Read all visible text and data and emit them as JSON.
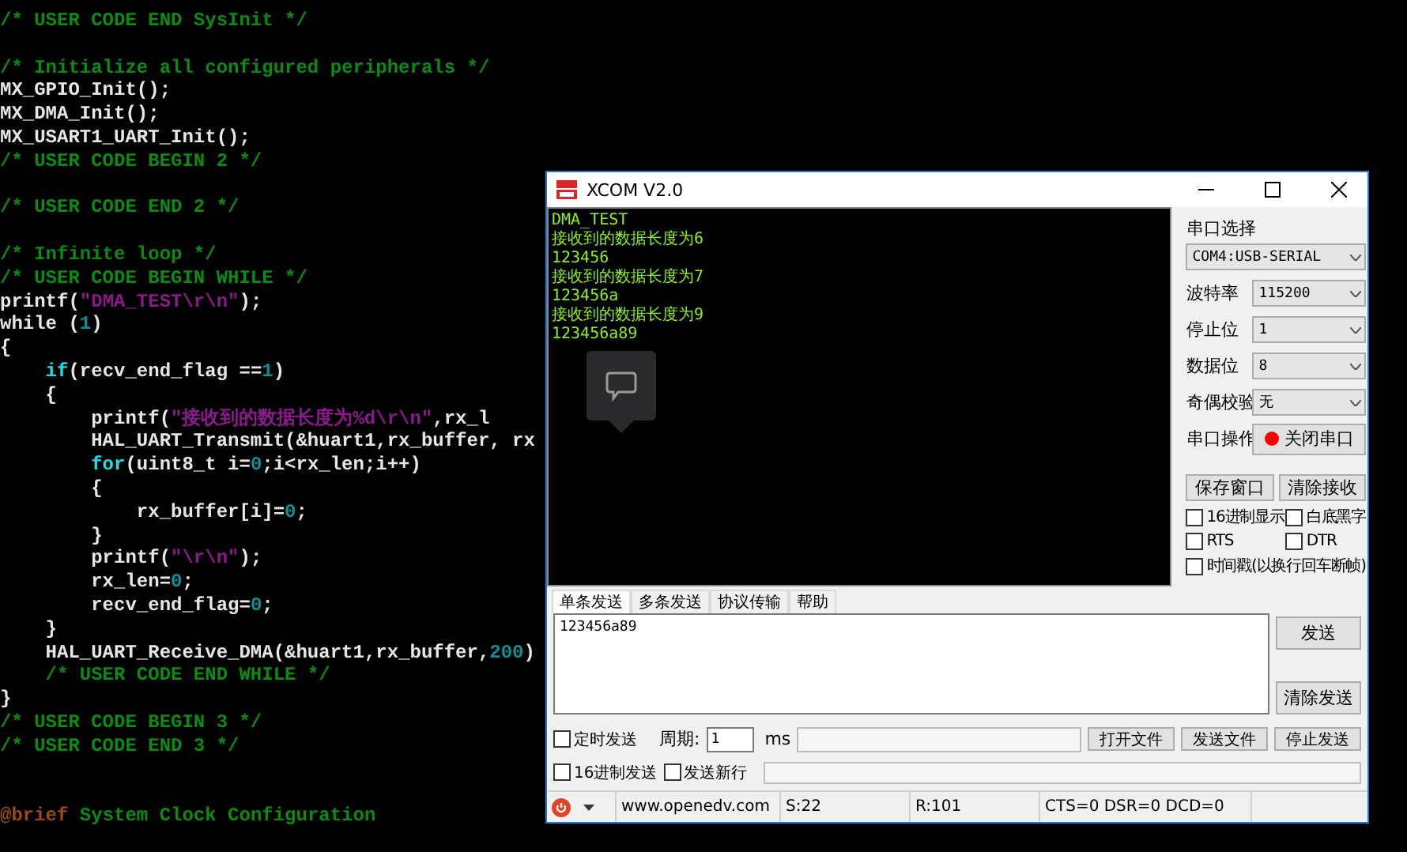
{
  "editor": {
    "lines": [
      {
        "kind": "code",
        "tokens": [
          {
            "kind": "comment",
            "text": "/* USER CODE END SysInit */"
          }
        ]
      },
      {
        "kind": "blank"
      },
      {
        "kind": "code",
        "tokens": [
          {
            "kind": "comment",
            "text": "/* Initialize all configured peripherals */"
          }
        ]
      },
      {
        "kind": "code",
        "tokens": [
          {
            "kind": "plain",
            "text": "MX_GPIO_Init();"
          }
        ]
      },
      {
        "kind": "code",
        "tokens": [
          {
            "kind": "plain",
            "text": "MX_DMA_Init();"
          }
        ]
      },
      {
        "kind": "code",
        "tokens": [
          {
            "kind": "plain",
            "text": "MX_USART1_UART_Init();"
          }
        ]
      },
      {
        "kind": "code",
        "tokens": [
          {
            "kind": "comment",
            "text": "/* USER CODE BEGIN 2 */"
          }
        ]
      },
      {
        "kind": "blank"
      },
      {
        "kind": "code",
        "tokens": [
          {
            "kind": "comment",
            "text": "/* USER CODE END 2 */"
          }
        ]
      },
      {
        "kind": "blank"
      },
      {
        "kind": "code",
        "tokens": [
          {
            "kind": "comment",
            "text": "/* Infinite loop */"
          }
        ]
      },
      {
        "kind": "code",
        "tokens": [
          {
            "kind": "comment",
            "text": "/* USER CODE BEGIN WHILE */"
          }
        ]
      },
      {
        "kind": "code",
        "tokens": [
          {
            "kind": "plain",
            "text": "printf("
          },
          {
            "kind": "string",
            "text": "\"DMA_TEST\\r\\n\""
          },
          {
            "kind": "plain",
            "text": ");"
          }
        ]
      },
      {
        "kind": "code",
        "tokens": [
          {
            "kind": "plain",
            "text": "while ("
          },
          {
            "kind": "number",
            "text": "1"
          },
          {
            "kind": "plain",
            "text": ")"
          }
        ]
      },
      {
        "kind": "code",
        "tokens": [
          {
            "kind": "plain",
            "text": "{"
          }
        ]
      },
      {
        "kind": "code",
        "tokens": [
          {
            "kind": "keyword",
            "text": "    if"
          },
          {
            "kind": "plain",
            "text": "(recv_end_flag =="
          },
          {
            "kind": "number",
            "text": "1"
          },
          {
            "kind": "plain",
            "text": ")"
          }
        ]
      },
      {
        "kind": "code",
        "tokens": [
          {
            "kind": "plain",
            "text": "    {"
          }
        ]
      },
      {
        "kind": "code",
        "tokens": [
          {
            "kind": "plain",
            "text": "        printf("
          },
          {
            "kind": "string",
            "text": "\"接收到的数据长度为%d\\r\\n\""
          },
          {
            "kind": "plain",
            "text": ",rx_l"
          }
        ]
      },
      {
        "kind": "code",
        "tokens": [
          {
            "kind": "plain",
            "text": "        HAL_UART_Transmit(&huart1,rx_buffer, rx"
          }
        ]
      },
      {
        "kind": "code",
        "tokens": [
          {
            "kind": "keyword",
            "text": "        for"
          },
          {
            "kind": "plain",
            "text": "(uint8_t i="
          },
          {
            "kind": "number",
            "text": "0"
          },
          {
            "kind": "plain",
            "text": ";i<rx_len;i++)"
          }
        ]
      },
      {
        "kind": "code",
        "tokens": [
          {
            "kind": "plain",
            "text": "        {"
          }
        ]
      },
      {
        "kind": "code",
        "tokens": [
          {
            "kind": "plain",
            "text": "            rx_buffer[i]="
          },
          {
            "kind": "number",
            "text": "0"
          },
          {
            "kind": "plain",
            "text": ";"
          }
        ]
      },
      {
        "kind": "code",
        "tokens": [
          {
            "kind": "plain",
            "text": "        }"
          }
        ]
      },
      {
        "kind": "code",
        "tokens": [
          {
            "kind": "plain",
            "text": "        printf("
          },
          {
            "kind": "string",
            "text": "\"\\r\\n\""
          },
          {
            "kind": "plain",
            "text": ");"
          }
        ]
      },
      {
        "kind": "code",
        "tokens": [
          {
            "kind": "plain",
            "text": "        rx_len="
          },
          {
            "kind": "number",
            "text": "0"
          },
          {
            "kind": "plain",
            "text": ";"
          }
        ]
      },
      {
        "kind": "code",
        "tokens": [
          {
            "kind": "plain",
            "text": "        recv_end_flag="
          },
          {
            "kind": "number",
            "text": "0"
          },
          {
            "kind": "plain",
            "text": ";"
          }
        ]
      },
      {
        "kind": "code",
        "tokens": [
          {
            "kind": "plain",
            "text": "    }"
          }
        ]
      },
      {
        "kind": "code",
        "tokens": [
          {
            "kind": "plain",
            "text": "    HAL_UART_Receive_DMA(&huart1,rx_buffer,"
          },
          {
            "kind": "number",
            "text": "200"
          },
          {
            "kind": "plain",
            "text": ")"
          }
        ]
      },
      {
        "kind": "code",
        "tokens": [
          {
            "kind": "comment",
            "text": "    /* USER CODE END WHILE */"
          }
        ]
      },
      {
        "kind": "code",
        "tokens": [
          {
            "kind": "plain",
            "text": "}"
          }
        ]
      },
      {
        "kind": "code",
        "tokens": [
          {
            "kind": "comment",
            "text": "/* USER CODE BEGIN 3 */"
          }
        ]
      },
      {
        "kind": "code",
        "tokens": [
          {
            "kind": "comment",
            "text": "/* USER CODE END 3 */"
          }
        ]
      },
      {
        "kind": "blank"
      },
      {
        "kind": "blank"
      },
      {
        "kind": "code",
        "tokens": [
          {
            "kind": "doctag",
            "text": "@brief"
          },
          {
            "kind": "comment",
            "text": " System Clock Configuration"
          }
        ]
      }
    ]
  },
  "xcom": {
    "title": "XCOM V2.0",
    "receive_lines": [
      "DMA_TEST",
      "接收到的数据长度为6",
      "123456",
      "接收到的数据长度为7",
      "123456a",
      "接收到的数据长度为9",
      "123456a89"
    ],
    "port_label": "串口选择",
    "port_value": "COM4:USB-SERIAL",
    "settings": [
      {
        "label": "波特率",
        "value": "115200"
      },
      {
        "label": "停止位",
        "value": "1"
      },
      {
        "label": "数据位",
        "value": "8"
      },
      {
        "label": "奇偶校验",
        "value": "无"
      }
    ],
    "operation_label": "串口操作",
    "operation_button": {
      "label": "关闭串口",
      "open": true
    },
    "receive_buttons": [
      "保存窗口",
      "清除接收"
    ],
    "receive_options": [
      {
        "label": "16进制显示",
        "checked": false
      },
      {
        "label": "白底黑字",
        "checked": false
      },
      {
        "label": "RTS",
        "checked": false
      },
      {
        "label": "DTR",
        "checked": false
      },
      {
        "label": "时间戳(以换行回车断帧)",
        "checked": false
      }
    ],
    "tabs": [
      {
        "label": "单条发送",
        "selected": true
      },
      {
        "label": "多条发送",
        "selected": false
      },
      {
        "label": "协议传输",
        "selected": false
      },
      {
        "label": "帮助",
        "selected": false
      }
    ],
    "send_text": "123456a89",
    "send_buttons": [
      "发送",
      "清除发送"
    ],
    "timed_send": {
      "label": "定时发送",
      "checked": false
    },
    "period_label": "周期:",
    "period_value": "1",
    "period_unit": "ms",
    "file_buttons": [
      "打开文件",
      "发送文件",
      "停止发送"
    ],
    "hex_send": {
      "label": "16进制发送",
      "checked": false
    },
    "send_newline": {
      "label": "发送新行",
      "checked": false
    },
    "progress": {
      "level": 0
    },
    "status": {
      "url": "www.openedv.com",
      "sent": "S:22",
      "received": "R:101",
      "lines": "CTS=0 DSR=0 DCD=0"
    }
  }
}
